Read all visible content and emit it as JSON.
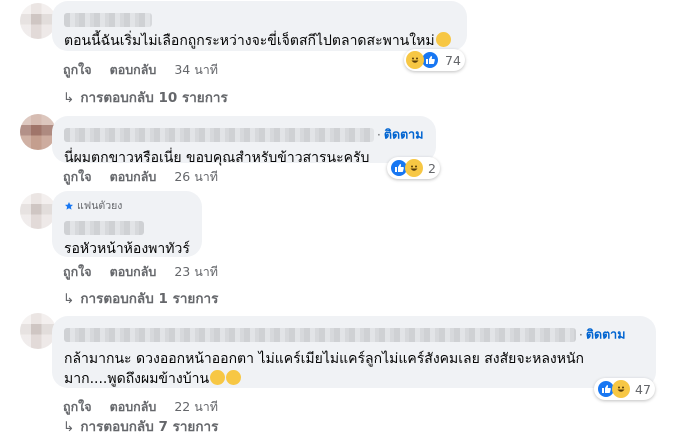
{
  "comments": [
    {
      "text": "ตอนนี้ฉันเริ่มไม่เลือกถูกระหว่างจะขี่เจ็ตสกีไปตลาดสะพานใหม่",
      "like_label": "ถูกใจ",
      "reply_label": "ตอบกลับ",
      "time": "34 นาที",
      "reaction_count": "74",
      "replies_label": "การตอบกลับ 10 รายการ"
    },
    {
      "follow_label": "ติดตาม",
      "text": "นี่ผมตกขาวหรือเนี่ย ขอบคุณสำหรับข้าวสารนะครับ",
      "like_label": "ถูกใจ",
      "reply_label": "ตอบกลับ",
      "time": "26 นาที",
      "reaction_count": "2"
    },
    {
      "badge": "แฟนตัวยง",
      "text": "รอหัวหน้าห้องพาทัวร์",
      "like_label": "ถูกใจ",
      "reply_label": "ตอบกลับ",
      "time": "23 นาที",
      "replies_label": "การตอบกลับ 1 รายการ"
    },
    {
      "follow_label": "ติดตาม",
      "text_line1": "กล้ามากนะ ดวงออกหน้าออกตา ไม่แคร์เมียไม่แคร์ลูกไม่แคร์สังคมเลย สงสัยจะหลงหนัก",
      "text_line2": "มาก....พูดถึงผมข้างบ้าน",
      "like_label": "ถูกใจ",
      "reply_label": "ตอบกลับ",
      "time": "22 นาที",
      "reaction_count": "47",
      "replies_label": "การตอบกลับ 7 รายการ"
    }
  ],
  "icons": {
    "haha": "haha-reaction-icon",
    "like": "like-reaction-icon",
    "reply_arrow": "reply-arrow-icon"
  },
  "colors": {
    "bubble": "#f0f2f5",
    "link": "#0064d1",
    "meta": "#65676b",
    "like_blue": "#1877f2",
    "haha_yellow": "#f7c744"
  }
}
